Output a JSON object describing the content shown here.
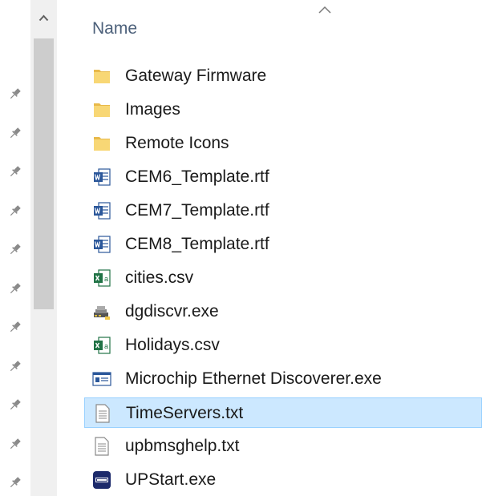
{
  "header": {
    "name_label": "Name"
  },
  "files": [
    {
      "name": "Gateway Firmware",
      "icon": "folder-icon",
      "selected": false
    },
    {
      "name": "Images",
      "icon": "folder-icon",
      "selected": false
    },
    {
      "name": "Remote Icons",
      "icon": "folder-icon",
      "selected": false
    },
    {
      "name": "CEM6_Template.rtf",
      "icon": "word-document-icon",
      "selected": false
    },
    {
      "name": "CEM7_Template.rtf",
      "icon": "word-document-icon",
      "selected": false
    },
    {
      "name": "CEM8_Template.rtf",
      "icon": "word-document-icon",
      "selected": false
    },
    {
      "name": "cities.csv",
      "icon": "excel-csv-icon",
      "selected": false
    },
    {
      "name": "dgdiscvr.exe",
      "icon": "network-device-exe-icon",
      "selected": false
    },
    {
      "name": "Holidays.csv",
      "icon": "excel-csv-icon",
      "selected": false
    },
    {
      "name": "Microchip Ethernet Discoverer.exe",
      "icon": "application-window-icon",
      "selected": false
    },
    {
      "name": "TimeServers.txt",
      "icon": "text-file-icon",
      "selected": true
    },
    {
      "name": "upbmsghelp.txt",
      "icon": "text-file-icon",
      "selected": false
    },
    {
      "name": "UPStart.exe",
      "icon": "upb-app-icon",
      "selected": false
    }
  ],
  "colors": {
    "selection_bg": "#cce8ff",
    "selection_border": "#99d1ff",
    "folder": "#f8d775",
    "word": "#2b579a",
    "excel": "#217346",
    "header_text": "#4c607a"
  }
}
